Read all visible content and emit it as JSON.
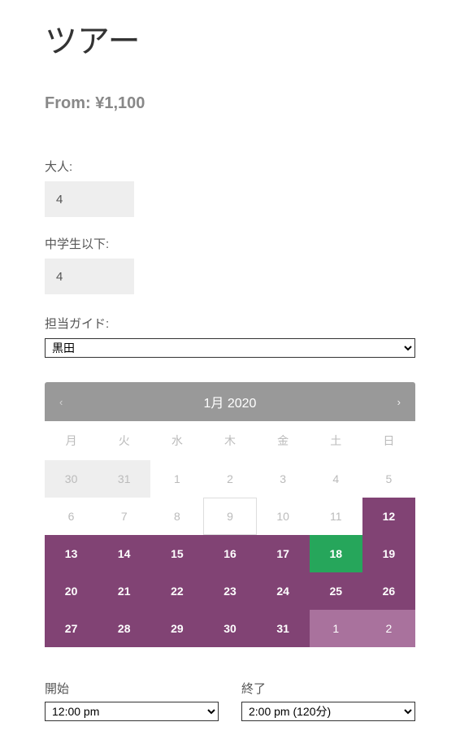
{
  "title": "ツアー",
  "price_prefix": "From: ",
  "price_value": "¥1,100",
  "fields": {
    "adult_label": "大人:",
    "adult_value": "4",
    "child_label": "中学生以下:",
    "child_value": "4",
    "guide_label": "担当ガイド:",
    "guide_value": "黒田"
  },
  "calendar": {
    "month_label": "1月 2020",
    "dow": [
      "月",
      "火",
      "水",
      "木",
      "金",
      "土",
      "日"
    ],
    "cells": [
      {
        "n": "30",
        "cls": "prev-month"
      },
      {
        "n": "31",
        "cls": "prev-month"
      },
      {
        "n": "1",
        "cls": ""
      },
      {
        "n": "2",
        "cls": ""
      },
      {
        "n": "3",
        "cls": ""
      },
      {
        "n": "4",
        "cls": ""
      },
      {
        "n": "5",
        "cls": ""
      },
      {
        "n": "6",
        "cls": ""
      },
      {
        "n": "7",
        "cls": ""
      },
      {
        "n": "8",
        "cls": ""
      },
      {
        "n": "9",
        "cls": "today"
      },
      {
        "n": "10",
        "cls": ""
      },
      {
        "n": "11",
        "cls": ""
      },
      {
        "n": "12",
        "cls": "active"
      },
      {
        "n": "13",
        "cls": "active"
      },
      {
        "n": "14",
        "cls": "active"
      },
      {
        "n": "15",
        "cls": "active"
      },
      {
        "n": "16",
        "cls": "active"
      },
      {
        "n": "17",
        "cls": "active"
      },
      {
        "n": "18",
        "cls": "selected"
      },
      {
        "n": "19",
        "cls": "active"
      },
      {
        "n": "20",
        "cls": "active"
      },
      {
        "n": "21",
        "cls": "active"
      },
      {
        "n": "22",
        "cls": "active"
      },
      {
        "n": "23",
        "cls": "active"
      },
      {
        "n": "24",
        "cls": "active"
      },
      {
        "n": "25",
        "cls": "active"
      },
      {
        "n": "26",
        "cls": "active"
      },
      {
        "n": "27",
        "cls": "active"
      },
      {
        "n": "28",
        "cls": "active"
      },
      {
        "n": "29",
        "cls": "active"
      },
      {
        "n": "30",
        "cls": "active"
      },
      {
        "n": "31",
        "cls": "active"
      },
      {
        "n": "1",
        "cls": "next-month-active"
      },
      {
        "n": "2",
        "cls": "next-month-active"
      }
    ]
  },
  "time": {
    "start_label": "開始",
    "start_value": "12:00 pm",
    "end_label": "終了",
    "end_value": "2:00 pm (120分)"
  }
}
